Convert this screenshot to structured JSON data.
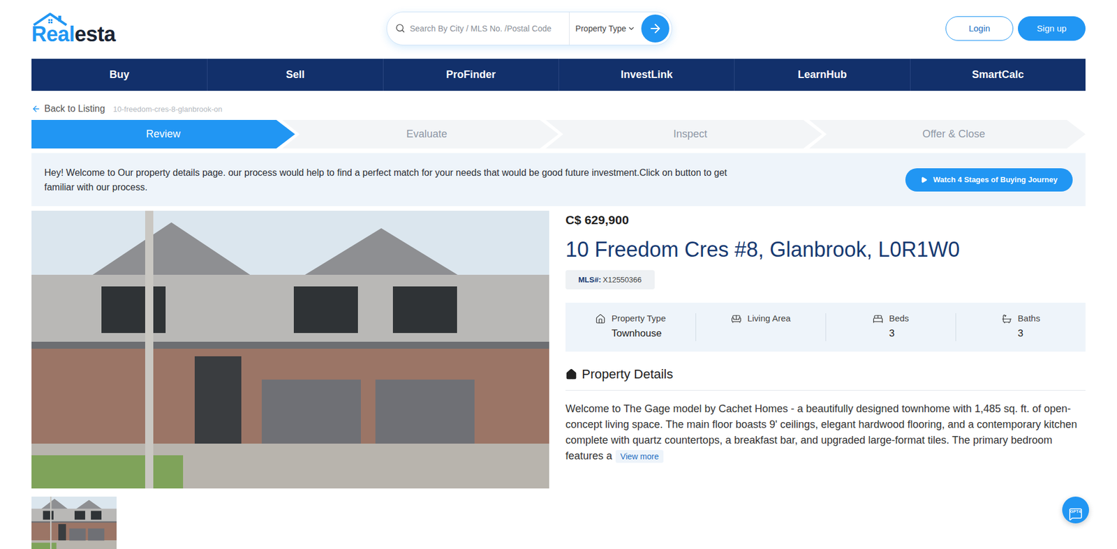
{
  "logo": {
    "part1": "Real",
    "part2": "esta"
  },
  "search": {
    "placeholder": "Search By City / MLS No. /Postal Code",
    "filter": "Property Type"
  },
  "auth": {
    "login": "Login",
    "signup": "Sign up"
  },
  "nav": [
    "Buy",
    "Sell",
    "ProFinder",
    "InvestLink",
    "LearnHub",
    "SmartCalc"
  ],
  "breadcrumb": {
    "back": "Back to Listing",
    "slug": "10-freedom-cres-8-glanbrook-on"
  },
  "steps": [
    {
      "label": "Review",
      "selected": true
    },
    {
      "label": "Evaluate",
      "selected": false
    },
    {
      "label": "Inspect",
      "selected": false
    },
    {
      "label": "Offer & Close",
      "selected": false
    }
  ],
  "banner": {
    "text": "Hey! Welcome to Our property details page. our process would help to find a perfect match for your needs that would be good future investment.Click on button to get familiar with our process.",
    "button": "Watch 4 Stages of Buying Journey"
  },
  "listing": {
    "price": "C$ 629,900",
    "address": "10 Freedom Cres #8, Glanbrook, L0R1W0",
    "mls_label": "MLS#:",
    "mls": "X12550366"
  },
  "stats": [
    {
      "label": "Property Type",
      "value": "Townhouse"
    },
    {
      "label": "Living Area"
    },
    {
      "label": "Beds",
      "value": "3"
    },
    {
      "label": "Baths",
      "value": "3"
    }
  ],
  "details": {
    "heading": "Property Details",
    "description": "Welcome to The Gage model by Cachet Homes - a beautifully designed townhome with 1,485 sq. ft. of open-concept living space. The main floor boasts 9' ceilings, elegant hardwood flooring, and a contemporary kitchen complete with quartz countertops, a breakfast bar, and upgraded large-format tiles. The primary bedroom features a",
    "more": "View more"
  },
  "chat": {
    "label": "GPT4"
  }
}
